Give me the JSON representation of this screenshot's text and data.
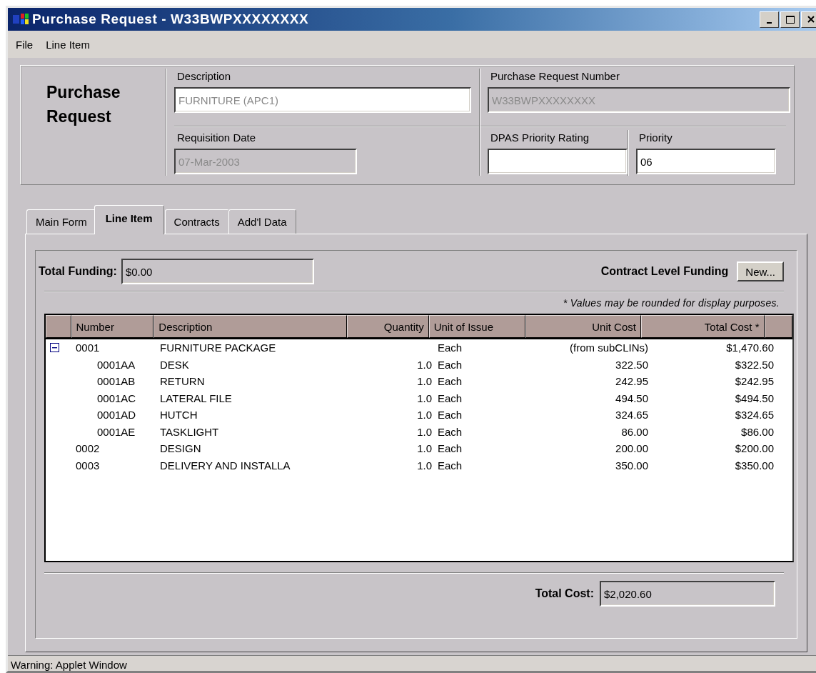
{
  "window": {
    "title": "Purchase Request - W33BWPXXXXXXXX"
  },
  "menu": [
    "File",
    "Line Item"
  ],
  "header": {
    "title": "Purchase Request",
    "fields": [
      {
        "label": "Description",
        "value": "FURNITURE (APC1)",
        "readonly": true,
        "disabled": false
      },
      {
        "label": "Purchase Request Number",
        "value": "W33BWPXXXXXXXX",
        "readonly": true,
        "disabled": true
      },
      {
        "label": "Requisition Date",
        "value": "07-Mar-2003",
        "readonly": true,
        "disabled": true
      },
      {
        "label": "DPAS Priority Rating",
        "disabled": false
      },
      {
        "label": "Priority",
        "value": "06",
        "readonly": false,
        "disabled": false
      }
    ]
  },
  "tabs": [
    {
      "label": "Main Form",
      "selected": false
    },
    {
      "label": "Line Item",
      "selected": true
    },
    {
      "label": "Contracts",
      "selected": false
    },
    {
      "label": "Add'l Data",
      "selected": false
    }
  ],
  "funding": {
    "label": "Total Funding:",
    "value": "$0.00",
    "contract_label": "Contract Level Funding",
    "new_button": "New..."
  },
  "note": "* Values may be rounded for display purposes.",
  "table": {
    "columns": [
      "Number",
      "Description",
      "Quantity",
      "Unit of Issue",
      "Unit Cost",
      "Total Cost *"
    ],
    "rows": [
      {
        "number": "0001",
        "description": "FURNITURE PACKAGE",
        "unit": "Each",
        "unit_cost": "(from subCLINs)",
        "total_cost": "$1,470.60",
        "expanded": true,
        "children": [
          {
            "number": "0001AA",
            "description": "DESK",
            "quantity": "1.0",
            "unit": "Each",
            "unit_cost": "322.50",
            "total_cost": "$322.50"
          },
          {
            "number": "0001AB",
            "description": "RETURN",
            "quantity": "1.0",
            "unit": "Each",
            "unit_cost": "242.95",
            "total_cost": "$242.95"
          },
          {
            "number": "0001AC",
            "description": "LATERAL FILE",
            "quantity": "1.0",
            "unit": "Each",
            "unit_cost": "494.50",
            "total_cost": "$494.50"
          },
          {
            "number": "0001AD",
            "description": "HUTCH",
            "quantity": "1.0",
            "unit": "Each",
            "unit_cost": "324.65",
            "total_cost": "$324.65"
          },
          {
            "number": "0001AE",
            "description": "TASKLIGHT",
            "quantity": "1.0",
            "unit": "Each",
            "unit_cost": "86.00",
            "total_cost": "$86.00"
          }
        ]
      },
      {
        "number": "0002",
        "description": "DESIGN",
        "quantity": "1.0",
        "unit": "Each",
        "unit_cost": "200.00",
        "total_cost": "$200.00"
      },
      {
        "number": "0003",
        "description": "DELIVERY AND INSTALLA",
        "quantity": "1.0",
        "unit": "Each",
        "unit_cost": "350.00",
        "total_cost": "$350.00"
      }
    ]
  },
  "total_cost": {
    "label": "Total Cost:",
    "value": "$2,020.60"
  },
  "status_bar": "Warning: Applet Window"
}
